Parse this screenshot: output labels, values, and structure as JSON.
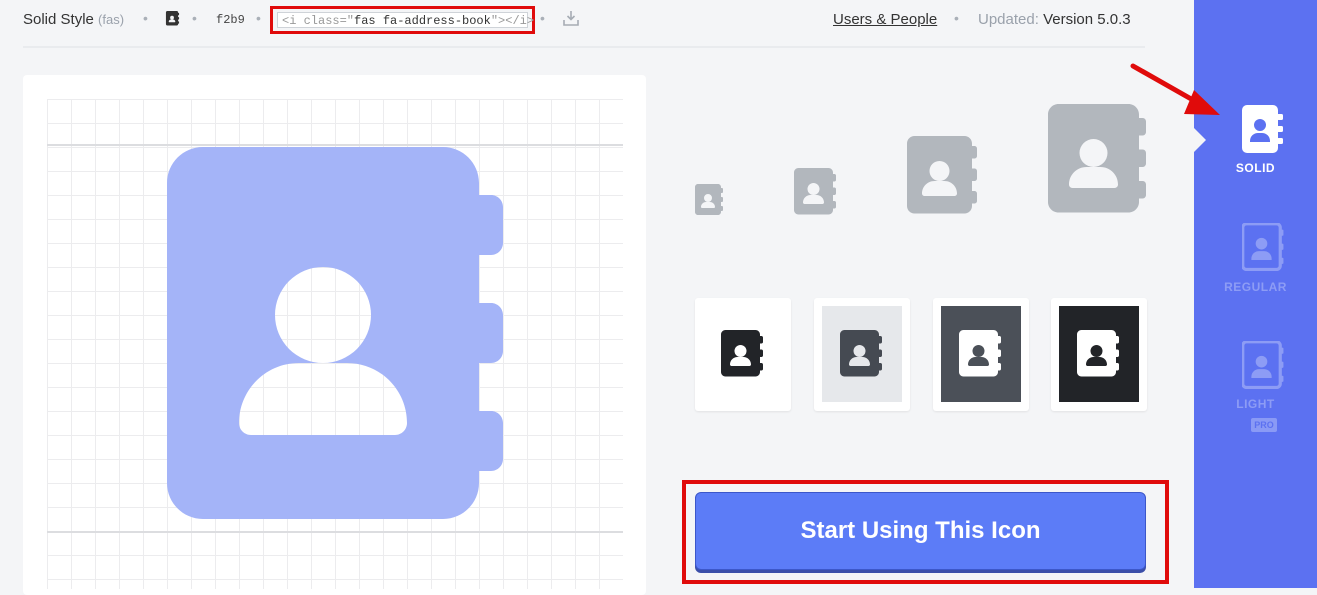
{
  "meta": {
    "style_label": "Solid Style",
    "style_prefix": "(fas)",
    "unicode": "f2b9",
    "code_open": "<i class=\"",
    "code_class": "fas fa-address-book",
    "code_close": "\"></i>",
    "category_link": "Users & People",
    "updated_label": "Updated:",
    "updated_value": "Version 5.0.3"
  },
  "icon": {
    "name": "address-book"
  },
  "tiles": [
    {
      "bg": "#ffffff",
      "icon": "#222428"
    },
    {
      "bg": "#e6e8eb",
      "icon": "#454a52"
    },
    {
      "bg": "#4b5058",
      "icon": "#ffffff"
    },
    {
      "bg": "#222428",
      "icon": "#ffffff"
    }
  ],
  "cta": {
    "label": "Start Using This Icon"
  },
  "styles": [
    {
      "label": "SOLID",
      "selected": true
    },
    {
      "label": "REGULAR",
      "selected": false
    },
    {
      "label": "LIGHT",
      "selected": false,
      "badge": "PRO"
    }
  ],
  "colors": {
    "accent": "#5c71f1",
    "preview_icon": "#a4b4f8",
    "size_icon": "#b2b7bd",
    "cta_bg": "#5c7cf7",
    "annotation": "#e00b0b"
  }
}
